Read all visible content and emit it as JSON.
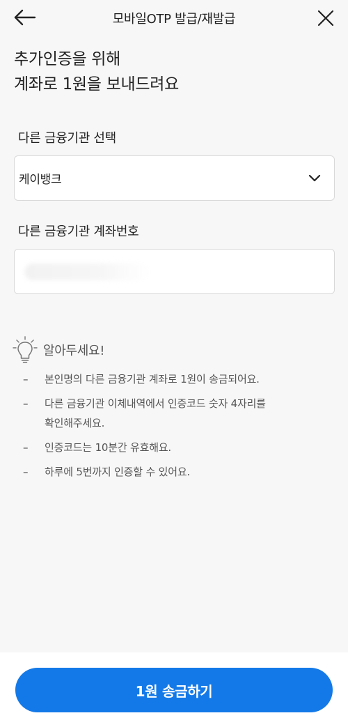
{
  "header": {
    "title": "모바일OTP 발급/재발급",
    "back_icon": "arrow-left-icon",
    "close_icon": "close-icon"
  },
  "headline": {
    "line1": "추가인증을 위해",
    "line2": "계좌로 1원을 보내드려요"
  },
  "form": {
    "bank_label": "다른 금융기관 선택",
    "bank_value": "케이뱅크",
    "account_label": "다른 금융기관 계좌번호",
    "account_value": ""
  },
  "notice": {
    "title": "알아두세요!",
    "icon": "lightbulb-icon",
    "items": [
      "본인명의 다른 금융기관 계좌로 1원이 송금되어요.",
      "다른 금융기관 이체내역에서 인증코드 숫자 4자리를",
      "확인해주세요.",
      "인증코드는 10분간 유효해요.",
      "하루에 5번까지 인증할 수 있어요."
    ]
  },
  "cta": {
    "label": "1원 송금하기"
  },
  "colors": {
    "primary": "#1479e8",
    "background": "#f7f7f7"
  }
}
